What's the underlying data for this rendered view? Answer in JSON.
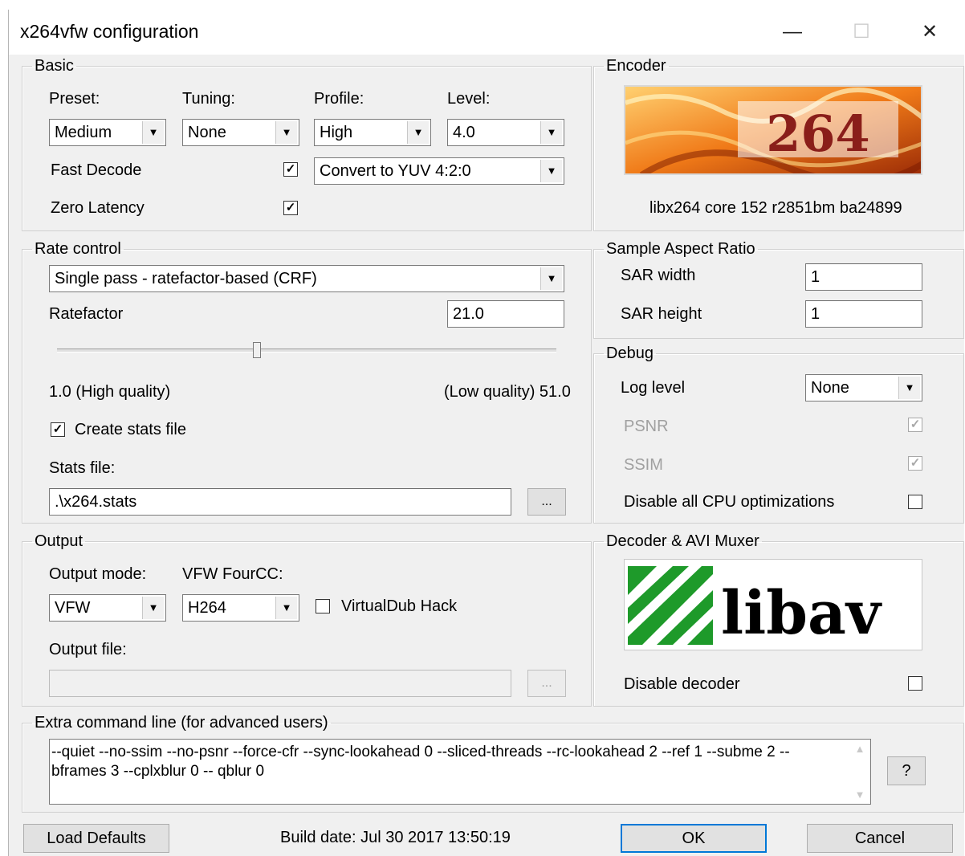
{
  "window": {
    "title": "x264vfw configuration",
    "minimize": "—",
    "maximize": "☐",
    "close": "✕"
  },
  "basic": {
    "legend": "Basic",
    "preset_label": "Preset:",
    "preset_value": "Medium",
    "tuning_label": "Tuning:",
    "tuning_value": "None",
    "profile_label": "Profile:",
    "profile_value": "High",
    "level_label": "Level:",
    "level_value": "4.0",
    "fast_decode_label": "Fast Decode",
    "fast_decode_checked": true,
    "zero_latency_label": "Zero Latency",
    "zero_latency_checked": true,
    "colorspace_value": "Convert to YUV 4:2:0"
  },
  "encoder": {
    "legend": "Encoder",
    "logo_text": "264",
    "version": "libx264 core 152 r2851bm ba24899"
  },
  "rate_control": {
    "legend": "Rate control",
    "mode_value": "Single pass - ratefactor-based (CRF)",
    "ratefactor_label": "Ratefactor",
    "ratefactor_value": "21.0",
    "slider_fraction": 0.4,
    "min_label": "1.0 (High quality)",
    "max_label": "(Low quality) 51.0",
    "create_stats_label": "Create stats file",
    "create_stats_checked": true,
    "stats_file_label": "Stats file:",
    "stats_file_value": ".\\x264.stats",
    "browse_label": "..."
  },
  "sar": {
    "legend": "Sample Aspect Ratio",
    "width_label": "SAR width",
    "width_value": "1",
    "height_label": "SAR height",
    "height_value": "1"
  },
  "debug": {
    "legend": "Debug",
    "log_level_label": "Log level",
    "log_level_value": "None",
    "psnr_label": "PSNR",
    "psnr_checked": true,
    "ssim_label": "SSIM",
    "ssim_checked": true,
    "disable_cpu_label": "Disable all CPU optimizations",
    "disable_cpu_checked": false
  },
  "output": {
    "legend": "Output",
    "mode_label": "Output mode:",
    "mode_value": "VFW",
    "fourcc_label": "VFW FourCC:",
    "fourcc_value": "H264",
    "vdub_label": "VirtualDub Hack",
    "vdub_checked": false,
    "file_label": "Output file:",
    "file_value": "",
    "browse_label": "..."
  },
  "decoder": {
    "legend": "Decoder & AVI Muxer",
    "logo_text": "libav",
    "disable_label": "Disable decoder",
    "disable_checked": false
  },
  "extra": {
    "legend": "Extra command line (for advanced users)",
    "value": "--quiet --no-ssim --no-psnr --force-cfr --sync-lookahead 0 --sliced-threads --rc-lookahead 2 --ref 1 --subme 2 --bframes 3 --cplxblur 0 -- qblur 0",
    "help_label": "?"
  },
  "footer": {
    "load_defaults": "Load Defaults",
    "build_date": "Build date: Jul 30 2017 13:50:19",
    "ok": "OK",
    "cancel": "Cancel"
  },
  "colors": {
    "dialog_bg": "#f0f0f0",
    "accent": "#0078d7",
    "libav_green": "#1e9a2a"
  }
}
